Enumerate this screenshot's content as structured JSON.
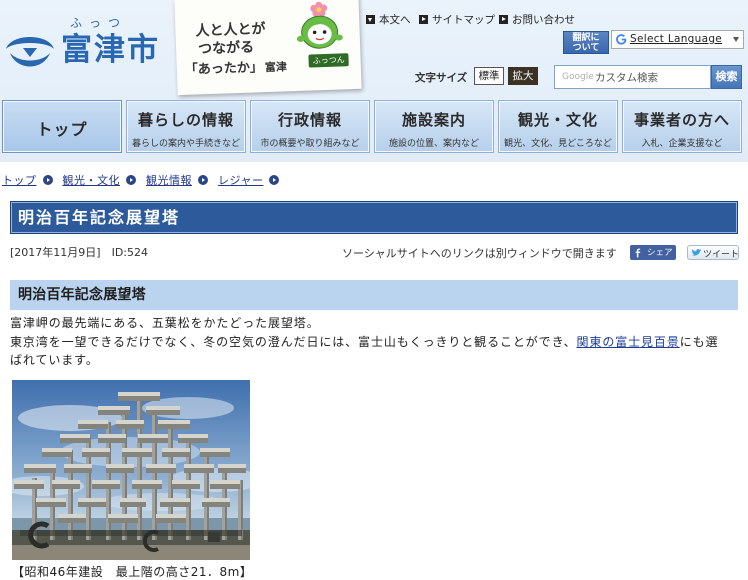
{
  "header": {
    "logo": {
      "kana": "ふっつ",
      "name": "富津市",
      "emblem_icon": "city-emblem-icon"
    },
    "banner": {
      "line1": "人と人とが",
      "line2": "つながる",
      "line3": "「あったか」",
      "line3_suffix": "富津",
      "mascot_name": "ふっつん"
    },
    "top_links": [
      {
        "label": "本文へ",
        "icon": "arrow-down-icon"
      },
      {
        "label": "サイトマップ",
        "icon": "arrow-right-icon"
      },
      {
        "label": "お問い合わせ",
        "icon": "arrow-right-icon"
      }
    ],
    "translate_button": {
      "line1": "翻訳に",
      "line2": "ついて"
    },
    "language_select": {
      "label": "Select Language",
      "icon": "google-g-icon"
    },
    "font_size": {
      "label": "文字サイズ",
      "options": [
        "標準",
        "拡大"
      ]
    },
    "search": {
      "brand": "Google",
      "placeholder": "カスタム検索",
      "button": "検索"
    }
  },
  "nav": [
    {
      "label": "トップ"
    },
    {
      "label": "暮らしの情報",
      "sub": "暮らしの案内や手続きなど"
    },
    {
      "label": "行政情報",
      "sub": "市の概要や取り組みなど"
    },
    {
      "label": "施設案内",
      "sub": "施設の位置、案内など"
    },
    {
      "label": "観光・文化",
      "sub": "観光、文化、見どころなど"
    },
    {
      "label": "事業者の方へ",
      "sub": "入札、企業支援など"
    }
  ],
  "breadcrumb": [
    "トップ",
    "観光・文化",
    "観光情報",
    "レジャー"
  ],
  "article": {
    "title": "明治百年記念展望塔",
    "date": "[2017年11月9日]",
    "id": "ID:524",
    "social_note": "ソーシャルサイトへのリンクは別ウィンドウで開きます",
    "share_button": "シェア",
    "tweet_button": "ツイート",
    "section_title": "明治百年記念展望塔",
    "paragraph1": "富津岬の最先端にある、五葉松をかたどった展望塔。",
    "paragraph2_before": "東京湾を一望できるだけでなく、冬の空気の澄んだ日には、富士山もくっきりと観ることができ、",
    "paragraph2_link": "関東の富士見百景",
    "paragraph2_after": "にも選ばれています。",
    "photo_caption": "【昭和46年建設　最上階の高さ21．8m】"
  },
  "colors": {
    "brand_blue": "#2a67b1",
    "title_bar": "#2c5a9a",
    "section_bar": "#bad3ee",
    "nav_tab": "#c4daf0",
    "link": "#23388a",
    "header_bg": "#e5eff9"
  }
}
